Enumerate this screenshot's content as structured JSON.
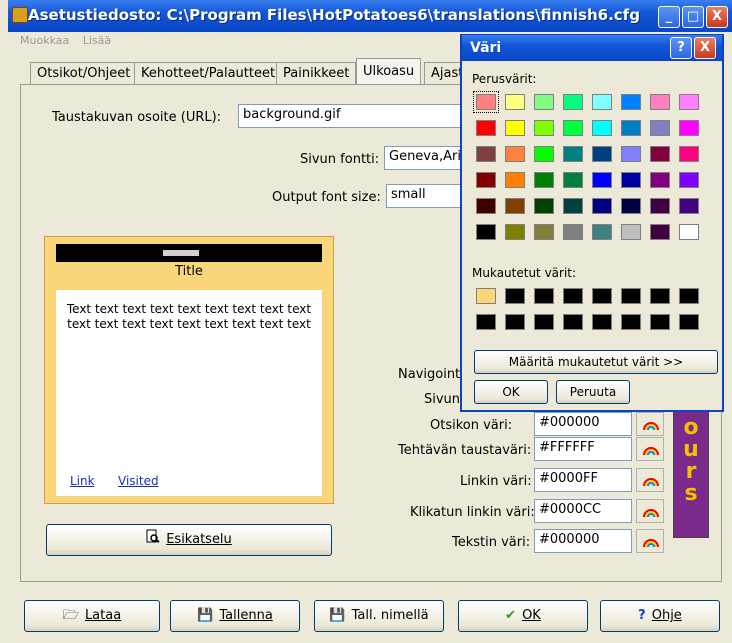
{
  "window": {
    "title": "Asetustiedosto: C:\\Program Files\\HotPotatoes6\\translations\\finnish6.cfg",
    "minimize": "_",
    "maximize": "□",
    "close": "X"
  },
  "menu": [
    "Muokkaa",
    "Lisää"
  ],
  "tabs": [
    "Otsikot/Ohjeet",
    "Kehotteet/Palautteet",
    "Painikkeet",
    "Ulkoasu",
    "Ajast"
  ],
  "form": {
    "bg_url_label": "Taustakuvan osoite (URL):",
    "bg_url_value": "background.gif",
    "font_label": "Sivun fontti:",
    "font_value": "Geneva,Ari",
    "font_size_label": "Output font size:",
    "font_size_value": "small",
    "nav_label": "Navigointi",
    "page_label": "Sivun",
    "colors": [
      {
        "label": "Otsikon väri:",
        "value": "#000000"
      },
      {
        "label": "Tehtävän taustaväri:",
        "value": "#FFFFFF"
      },
      {
        "label": "Linkin väri:",
        "value": "#0000FF"
      },
      {
        "label": "Klikatun linkin väri:",
        "value": "#0000CC"
      },
      {
        "label": "Tekstin väri:",
        "value": "#000000"
      }
    ]
  },
  "preview": {
    "title": "Title",
    "text": "Text text text text text text text text text text text text text text text text text text",
    "link": "Link",
    "visited": "Visited",
    "bg_color": "#fad67a"
  },
  "preview_button": "Esikatselu",
  "colours_badge": "ours",
  "bottom_buttons": [
    "Lataa",
    "Tallenna",
    "Tall. nimellä",
    "OK",
    "Ohje"
  ],
  "dialog": {
    "title": "Väri",
    "help": "?",
    "close": "X",
    "basic_label": "Perusvärit:",
    "basic_colors": [
      "#ff8080",
      "#ffff80",
      "#80ff80",
      "#00ff80",
      "#80ffff",
      "#0080ff",
      "#ff80c0",
      "#ff80ff",
      "#ff0000",
      "#ffff00",
      "#80ff00",
      "#00ff40",
      "#00ffff",
      "#0080c0",
      "#8080c0",
      "#ff00ff",
      "#804040",
      "#ff8040",
      "#00ff00",
      "#008080",
      "#004080",
      "#8080ff",
      "#800040",
      "#ff0080",
      "#800000",
      "#ff8000",
      "#008000",
      "#008040",
      "#0000ff",
      "#0000a0",
      "#800080",
      "#8000ff",
      "#400000",
      "#804000",
      "#004000",
      "#004040",
      "#000080",
      "#000040",
      "#400040",
      "#400080",
      "#000000",
      "#808000",
      "#808040",
      "#808080",
      "#408080",
      "#c0c0c0",
      "#400040",
      "#ffffff"
    ],
    "custom_label": "Mukautetut värit:",
    "custom_colors": [
      "#fad67a",
      "#000000",
      "#000000",
      "#000000",
      "#000000",
      "#000000",
      "#000000",
      "#000000",
      "#000000",
      "#000000",
      "#000000",
      "#000000",
      "#000000",
      "#000000",
      "#000000",
      "#000000"
    ],
    "define_button": "Määritä mukautetut värit >>",
    "ok": "OK",
    "cancel": "Peruuta"
  }
}
